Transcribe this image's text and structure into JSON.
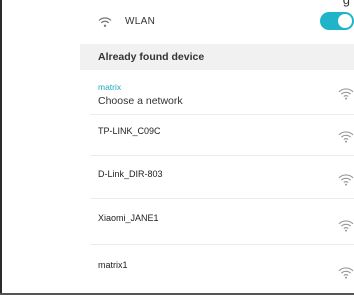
{
  "header": {
    "partial_text": "g"
  },
  "wlan": {
    "label": "WLAN",
    "toggle_on": true,
    "accent": "#1fb4c8"
  },
  "section": {
    "title": "Already found device"
  },
  "networks": [
    {
      "name": "matrix",
      "subtitle": "Choose a network",
      "active": true,
      "icon": "wifi-icon"
    },
    {
      "name": "TP-LINK_C09C",
      "icon": "wifi-icon"
    },
    {
      "name": "D-Link_DIR-803",
      "icon": "wifi-icon"
    },
    {
      "name": "Xiaomi_JANE1",
      "icon": "wifi-icon"
    },
    {
      "name": "matrix1",
      "icon": "wifi-icon"
    }
  ]
}
